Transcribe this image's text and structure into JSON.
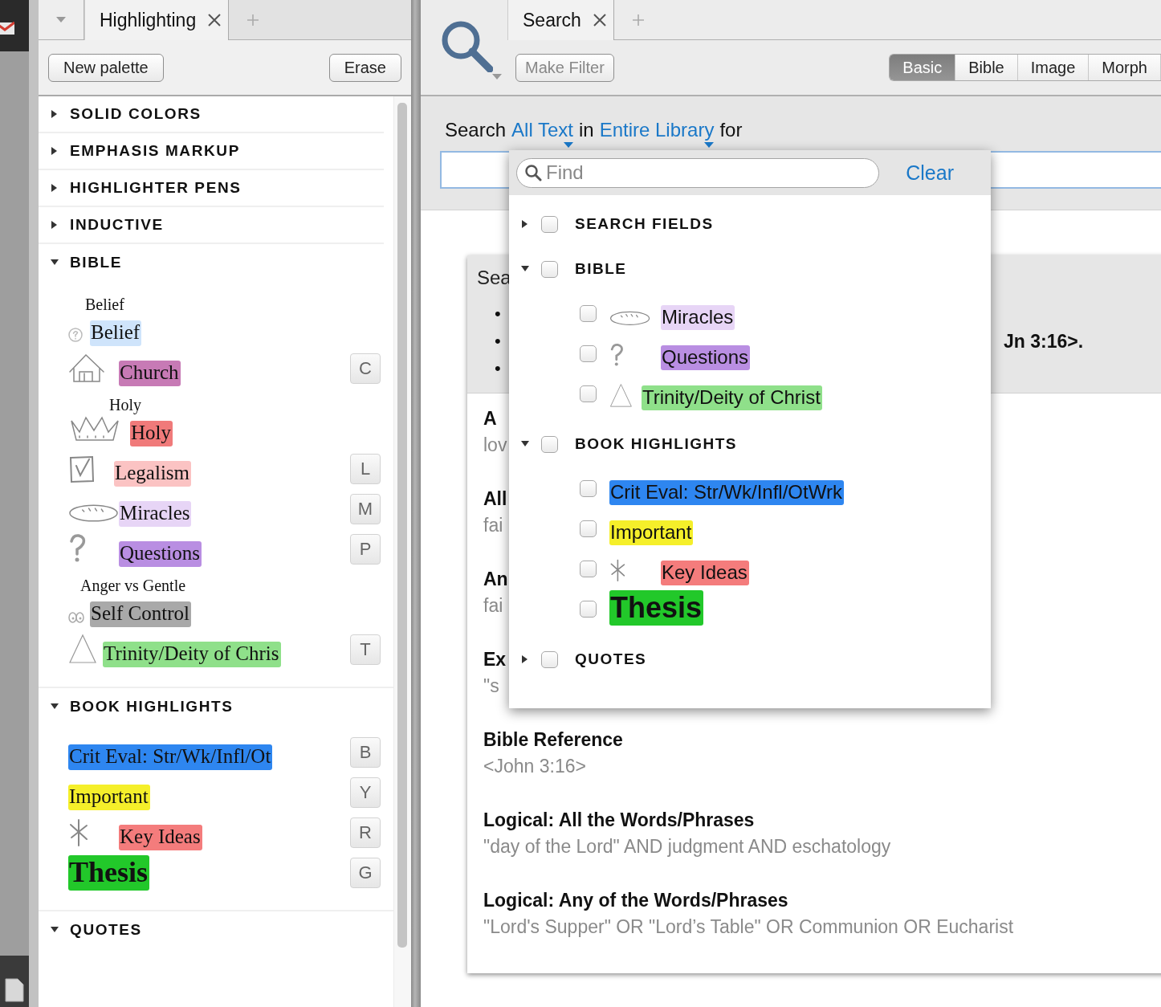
{
  "highlighting": {
    "tab": {
      "label": "Highlighting",
      "selected": true
    },
    "buttons": [
      "New palette",
      "Erase"
    ],
    "sections": [
      {
        "title": "SOLID COLORS",
        "expanded": false
      },
      {
        "title": "EMPHASIS MARKUP",
        "expanded": false
      },
      {
        "title": "HIGHLIGHTER PENS",
        "expanded": false
      },
      {
        "title": "INDUCTIVE",
        "expanded": false
      },
      {
        "title": "BIBLE",
        "expanded": true,
        "items": [
          {
            "kind": "note",
            "caption": "Belief",
            "label": "Belief",
            "color": "#cfe4fb"
          },
          {
            "kind": "house",
            "label": "Church",
            "color": "#c77ab5",
            "shortcut": "C"
          },
          {
            "kind": "crown",
            "caption": "Holy",
            "label": "Holy",
            "color": "#f07a7a"
          },
          {
            "kind": "check",
            "label": "Legalism",
            "color": "#fbc3c3",
            "shortcut": "L"
          },
          {
            "kind": "bread",
            "label": "Miracles",
            "color": "#e7d5f6",
            "shortcut": "M"
          },
          {
            "kind": "question",
            "label": "Questions",
            "color": "#b98ee2",
            "shortcut": "P"
          },
          {
            "kind": "eyes",
            "caption": "Anger vs Gentle",
            "label": "Self Control",
            "color": "#a9a9a9"
          },
          {
            "kind": "triangle",
            "label": "Trinity/Deity of Chris",
            "color": "#8fe08a",
            "shortcut": "T"
          }
        ]
      },
      {
        "title": "BOOK HIGHLIGHTS",
        "expanded": true,
        "items": [
          {
            "kind": "plain",
            "label": "Crit Eval: Str/Wk/Infl/Ot",
            "color": "#2e86f0",
            "shortcut": "B"
          },
          {
            "kind": "plain",
            "label": "Important",
            "color": "#f5ef2a",
            "shortcut": "Y"
          },
          {
            "kind": "asterisk",
            "label": "Key Ideas",
            "color": "#f47c7c",
            "shortcut": "R"
          },
          {
            "kind": "bold",
            "label": "Thesis",
            "color": "#22c82a",
            "shortcut": "G"
          }
        ]
      },
      {
        "title": "QUOTES",
        "expanded": true
      }
    ]
  },
  "search": {
    "tab": {
      "label": "Search",
      "selected": true
    },
    "make_filter": "Make Filter",
    "modes": [
      {
        "label": "Basic",
        "selected": true
      },
      {
        "label": "Bible",
        "selected": false
      },
      {
        "label": "Image",
        "selected": false
      },
      {
        "label": "Morph",
        "selected": false
      }
    ],
    "query": {
      "prefix": "Search",
      "scope": "All Text",
      "middle": "in",
      "library": "Entire Library",
      "suffix": "for"
    },
    "help": {
      "heading": "Sea",
      "bullets": [
        {
          "mark": "•"
        },
        {
          "mark": "•",
          "tail": "Jn 3:16>."
        },
        {
          "mark": "•"
        }
      ],
      "sections": [
        {
          "title": "A",
          "example": "lov"
        },
        {
          "title": "All",
          "example": "fai"
        },
        {
          "title": "An",
          "example": "fai"
        },
        {
          "title": "Ex",
          "example": "\"s"
        },
        {
          "title": "Bible Reference",
          "example": "<John 3:16>"
        },
        {
          "title": "Logical: All the Words/Phrases",
          "example": "\"day of the Lord\" AND judgment AND eschatology"
        },
        {
          "title": "Logical: Any of the Words/Phrases",
          "example": "\"Lord's Supper\" OR \"Lord’s Table\" OR Communion OR Eucharist"
        }
      ]
    },
    "field_picker": {
      "placeholder": "Find",
      "clear": "Clear",
      "groups": [
        {
          "title": "SEARCH FIELDS",
          "expanded": false,
          "checked": false
        },
        {
          "title": "BIBLE",
          "expanded": true,
          "checked": false,
          "items": [
            {
              "kind": "bread",
              "label": "Miracles",
              "color": "#e7d5f6",
              "checked": false
            },
            {
              "kind": "question",
              "label": "Questions",
              "color": "#b98ee2",
              "checked": false
            },
            {
              "kind": "triangle",
              "label": "Trinity/Deity of Christ",
              "color": "#8fe08a",
              "checked": false
            }
          ]
        },
        {
          "title": "BOOK HIGHLIGHTS",
          "expanded": true,
          "checked": false,
          "items": [
            {
              "kind": "plain",
              "label": "Crit Eval: Str/Wk/Infl/OtWrk",
              "color": "#2e86f0",
              "checked": false
            },
            {
              "kind": "plain",
              "label": "Important",
              "color": "#f5ef2a",
              "checked": false
            },
            {
              "kind": "asterisk",
              "label": "Key Ideas",
              "color": "#f47c7c",
              "checked": false
            },
            {
              "kind": "bold",
              "label": "Thesis",
              "color": "#22c82a",
              "checked": false
            }
          ]
        },
        {
          "title": "QUOTES",
          "expanded": false,
          "checked": false
        }
      ]
    }
  }
}
